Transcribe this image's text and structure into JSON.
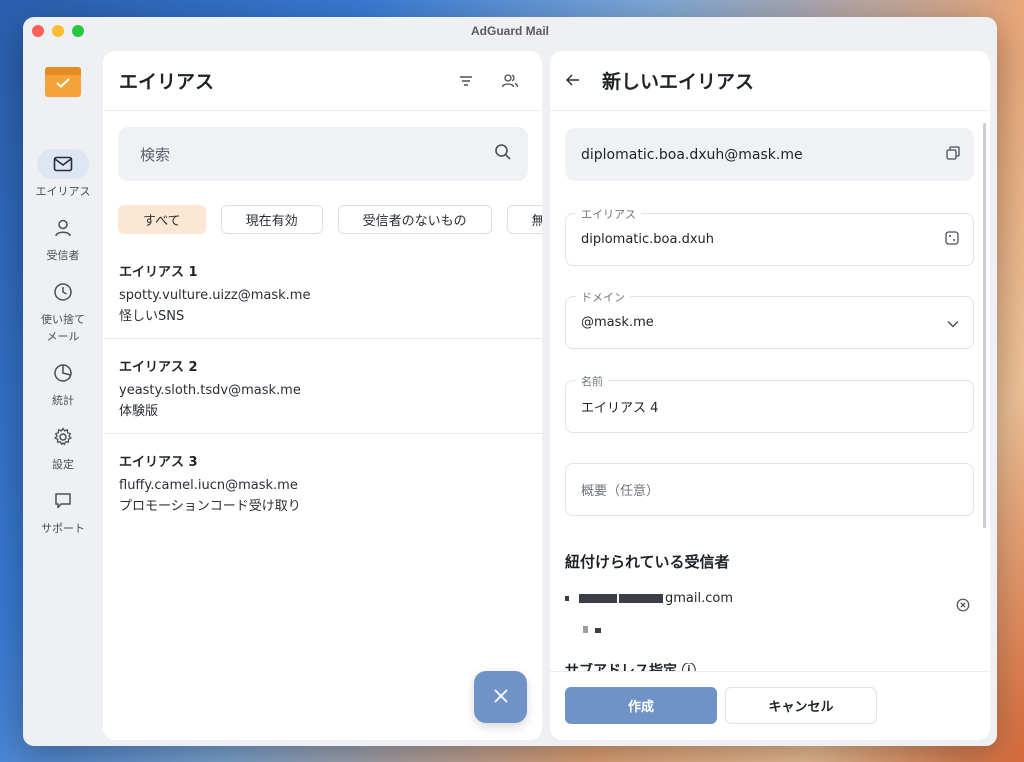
{
  "window": {
    "title": "AdGuard Mail"
  },
  "nav": {
    "items": [
      {
        "label": "エイリアス",
        "icon": "mail-icon",
        "active": true
      },
      {
        "label": "受信者",
        "icon": "person-icon"
      },
      {
        "label": "使い捨て\nメール",
        "icon": "clock-icon"
      },
      {
        "label": "統計",
        "icon": "pie-chart-icon"
      },
      {
        "label": "設定",
        "icon": "gear-icon"
      },
      {
        "label": "サポート",
        "icon": "chat-bubble-icon"
      }
    ]
  },
  "list": {
    "title": "エイリアス",
    "search_placeholder": "検索",
    "chips": [
      "すべて",
      "現在有効",
      "受信者のないもの",
      "無"
    ],
    "aliases": [
      {
        "name": "エイリアス 1",
        "address": "spotty.vulture.uizz@mask.me",
        "note": "怪しいSNS"
      },
      {
        "name": "エイリアス 2",
        "address": "yeasty.sloth.tsdv@mask.me",
        "note": "体験版"
      },
      {
        "name": "エイリアス 3",
        "address": "fluffy.camel.iucn@mask.me",
        "note": "プロモーションコード受け取り"
      }
    ]
  },
  "detail": {
    "title": "新しいエイリアス",
    "full_address": "diplomatic.boa.dxuh@mask.me",
    "alias_label": "エイリアス",
    "alias_value": "diplomatic.boa.dxuh",
    "domain_label": "ドメイン",
    "domain_value": "@mask.me",
    "name_label": "名前",
    "name_value": "エイリアス 4",
    "description_placeholder": "概要（任意）",
    "recipients_title": "紐付けられている受信者",
    "recipient_email_suffix": "gmail.com",
    "create_label": "作成",
    "cancel_label": "キャンセル"
  }
}
